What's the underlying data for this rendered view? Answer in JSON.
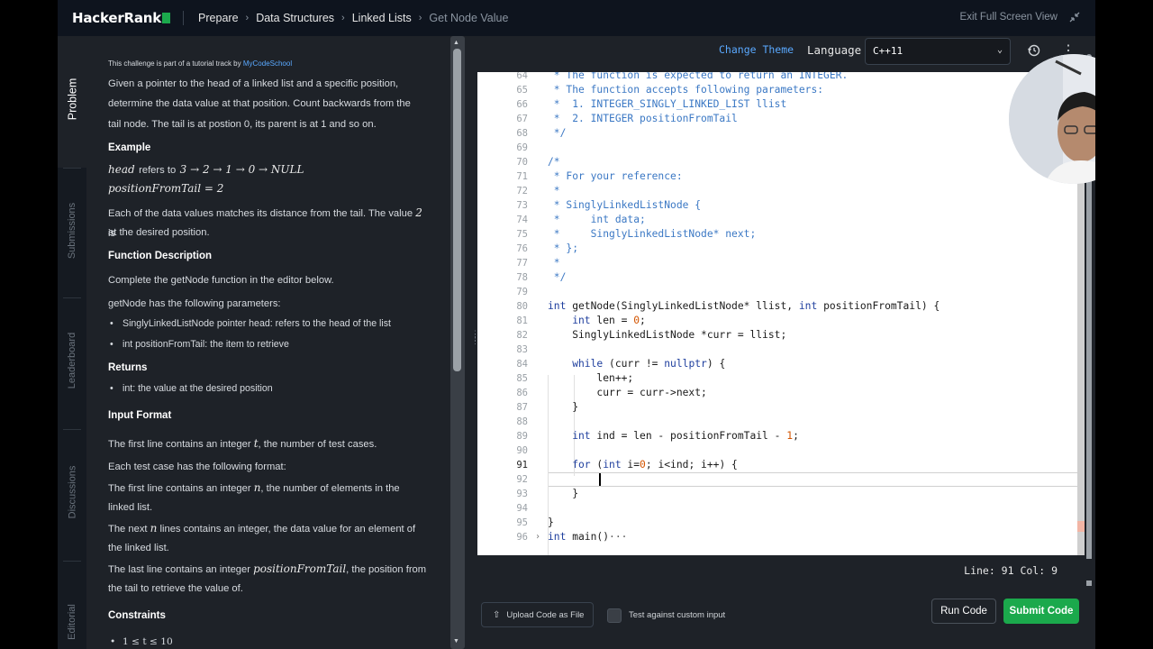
{
  "topbar": {
    "logo": "HackerRank",
    "breadcrumbs": [
      "Prepare",
      "Data Structures",
      "Linked Lists",
      "Get Node Value"
    ],
    "exit_fullscreen": "Exit Full Screen View"
  },
  "side_tabs": [
    "Problem",
    "Submissions",
    "Leaderboard",
    "Discussions",
    "Editorial"
  ],
  "problem": {
    "tutorial_note": "This challenge is part of a tutorial track by",
    "tutorial_link": "MyCodeSchool",
    "intro_1": "Given a pointer to the head of a linked list and a specific position,",
    "intro_2": "determine the data value at that position. Count backwards from the",
    "intro_3": "tail node. The tail is at postion 0, its parent is at 1 and so on.",
    "example_heading": "Example",
    "example_head": "head",
    "example_refers": "refers to",
    "example_list": "3 → 2 → 1 → 0 → NULL",
    "example_pos": "positionFromTail = 2",
    "example_note_1": "Each of the data values matches its distance from the tail. The value",
    "example_note_val": "2",
    "example_note_is": "is",
    "example_note_2": "at the desired position.",
    "fd_heading": "Function Description",
    "fd_1": "Complete the getNode function in the editor below.",
    "fd_2": "getNode has the following parameters:",
    "params": [
      "SinglyLinkedListNode pointer head: refers to the head of the list",
      "int positionFromTail: the item to retrieve"
    ],
    "returns_heading": "Returns",
    "returns": [
      "int: the value at the desired position"
    ],
    "input_heading": "Input Format",
    "in_1a": "The first line contains an integer",
    "in_1v": "t",
    "in_1b": ", the number of test cases.",
    "in_2": "Each test case has the following format:",
    "in_3a": "The first line contains an integer",
    "in_3v": "n",
    "in_3b": ", the number of elements in the",
    "in_3c": "linked list.",
    "in_4a": "The next",
    "in_4v": "n",
    "in_4b": "lines contains an integer, the data value for an element of",
    "in_4c": "the linked list.",
    "in_5a": "The last line contains an integer",
    "in_5v": "positionFromTail",
    "in_5b": ", the position from",
    "in_5c": "the tail to retrieve the value of.",
    "constraints_heading": "Constraints",
    "constraint_1": "1 ≤ t ≤ 10"
  },
  "editor_toolbar": {
    "change_theme": "Change Theme",
    "language_label": "Language",
    "language_value": "C++11"
  },
  "code": {
    "l64": " * The function is expected to return an INTEGER.",
    "l65": " * The function accepts following parameters:",
    "l66": " *  1. INTEGER_SINGLY_LINKED_LIST llist",
    "l67": " *  2. INTEGER positionFromTail",
    "l68": " */",
    "l70": "/*",
    "l71": " * For your reference:",
    "l72": " *",
    "l73": " * SinglyLinkedListNode {",
    "l74": " *     int data;",
    "l75": " *     SinglyLinkedListNode* next;",
    "l76": " * };",
    "l77": " *",
    "l78": " */",
    "l80a": "int",
    "l80b": " getNode(SinglyLinkedListNode* llist, ",
    "l80c": "int",
    "l80d": " positionFromTail) {",
    "l81a": "    int",
    "l81b": " len = ",
    "l81c": "0",
    "l81d": ";",
    "l82": "    SinglyLinkedListNode *curr = llist;",
    "l84a": "    while",
    "l84b": " (curr != ",
    "l84c": "nullptr",
    "l84d": ") {",
    "l85": "        len++;",
    "l86": "        curr = curr->next;",
    "l87": "    }",
    "l89a": "    int",
    "l89b": " ind = len - positionFromTail - ",
    "l89c": "1",
    "l89d": ";",
    "l91a": "    for",
    "l91b": " (",
    "l91c": "int",
    "l91d": " i=",
    "l91e": "0",
    "l91f": "; i<ind; i++) {",
    "l93": "    }",
    "l95": "}",
    "l97a": "int",
    "l97b": " main()",
    "l97c": "···"
  },
  "line_numbers": [
    "64",
    "65",
    "66",
    "67",
    "68",
    "69",
    "70",
    "71",
    "72",
    "73",
    "74",
    "75",
    "76",
    "77",
    "78",
    "79",
    "80",
    "81",
    "82",
    "83",
    "84",
    "85",
    "86",
    "87",
    "88",
    "89",
    "90",
    "91",
    "92",
    "93",
    "94",
    "95",
    "96"
  ],
  "status": {
    "line_col": "Line: 91 Col: 9"
  },
  "actions": {
    "upload": "Upload Code as File",
    "custom_input": "Test against custom input",
    "run": "Run Code",
    "submit": "Submit Code"
  },
  "colors": {
    "brand_green": "#1ba94c",
    "link_blue": "#5aa9ff"
  }
}
